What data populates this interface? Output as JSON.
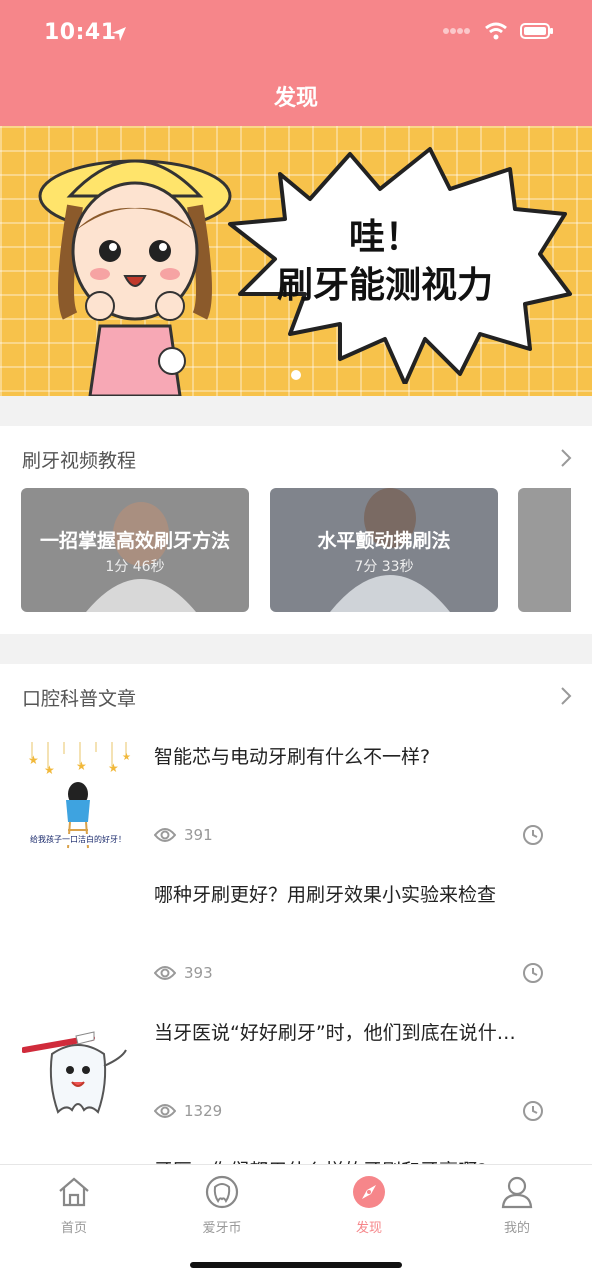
{
  "status_bar": {
    "time": "10:41"
  },
  "header": {
    "title": "发现"
  },
  "banner": {
    "line1": "哇！",
    "line2": "刷牙能测视力"
  },
  "video_section": {
    "title": "刷牙视频教程",
    "videos": [
      {
        "title": "一招掌握高效刷牙方法",
        "duration": "1分 46秒"
      },
      {
        "title": "水平颤动拂刷法",
        "duration": "7分 33秒"
      }
    ]
  },
  "article_section": {
    "title": "口腔科普文章",
    "articles": [
      {
        "title": "智能芯与电动牙刷有什么不一样?",
        "views": "391",
        "thumb_caption": "给我孩子一口洁白的好牙！"
      },
      {
        "title": "哪种牙刷更好？用刷牙效果小实验来检查",
        "views": "393"
      },
      {
        "title": "当牙医说“好好刷牙”时，他们到底在说什…",
        "views": "1329"
      },
      {
        "title": "牙医，你们都用什么样的牙刷和牙膏啊?"
      }
    ]
  },
  "tabbar": {
    "tabs": [
      {
        "label": "首页",
        "icon": "home-icon"
      },
      {
        "label": "爱牙币",
        "icon": "tooth-coin-icon"
      },
      {
        "label": "发现",
        "icon": "compass-icon"
      },
      {
        "label": "我的",
        "icon": "user-icon"
      }
    ],
    "active_index": 2
  },
  "colors": {
    "accent": "#f6868a",
    "banner_bg": "#f7c24b",
    "gray_text": "#999999"
  }
}
